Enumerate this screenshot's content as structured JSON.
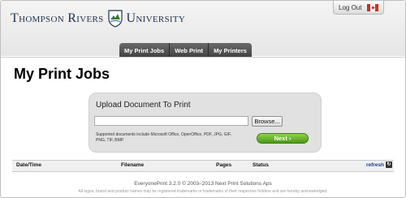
{
  "header": {
    "logo_left": "Thompson Rivers",
    "logo_right": "University",
    "logout_label": "Log Out"
  },
  "nav": {
    "tabs": [
      {
        "label": "My Print Jobs"
      },
      {
        "label": "Web Print"
      },
      {
        "label": "My Printers"
      }
    ]
  },
  "page": {
    "title": "My Print Jobs"
  },
  "upload": {
    "title": "Upload Document To Print",
    "file_value": "",
    "browse_label": "Browse...",
    "supported_text": "Supported documents include Microsoft Office, OpenOffice, PDF, JPG, GIF, PNG, TIF, BMP.",
    "next_label": "Next ›"
  },
  "jobs_table": {
    "columns": [
      "Date/Time",
      "Filename",
      "Pages",
      "Status"
    ],
    "refresh_label": "refresh",
    "rows": []
  },
  "footer": {
    "copyright": "EveryonePrint 3.2.0 © 2003–2013 Next Print Solutions Aps",
    "disclaimer": "All logos, brand and product names may be registered trademarks or trademarks of their respective holders and are hereby acknowledged."
  },
  "colors": {
    "tab_bg": "#4f4f4f",
    "next_button": "#5aac1e",
    "link": "#1a3c8c",
    "brand_navy": "#23334f"
  },
  "icons": {
    "crest": "tru-crest-icon",
    "flag": "canada-flag-icon",
    "refresh": "refresh-icon"
  }
}
